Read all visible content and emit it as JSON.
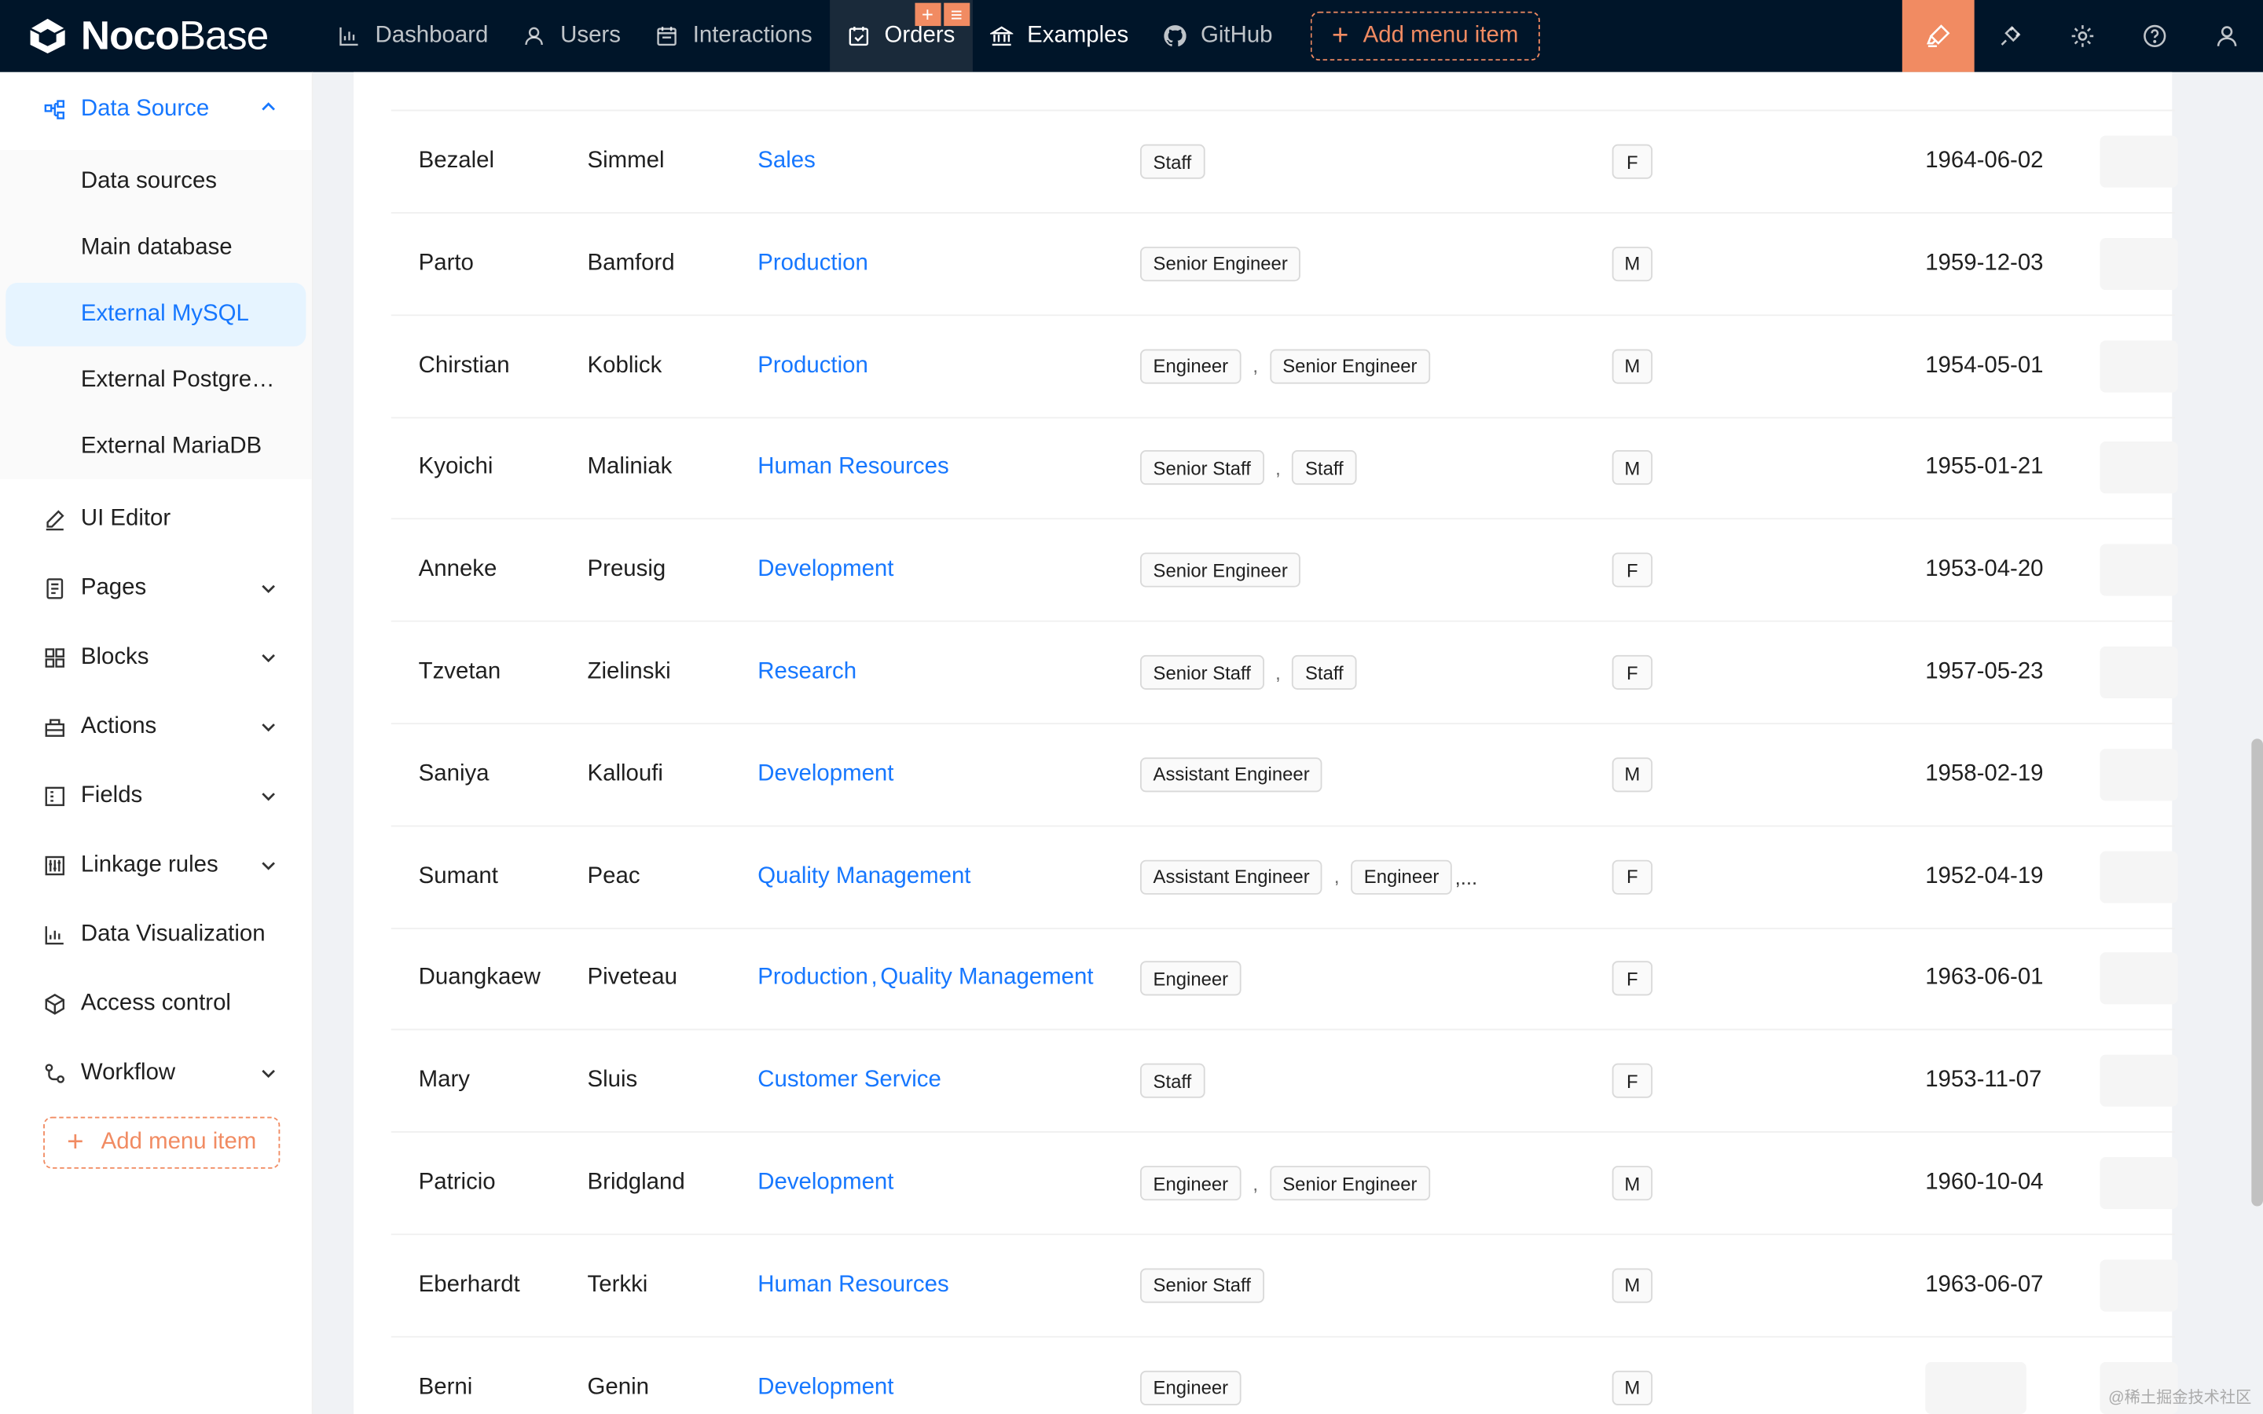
{
  "brand": {
    "bold": "Noco",
    "light": "Base"
  },
  "topnav": [
    {
      "label": "Dashboard",
      "icon": "bar-chart-icon"
    },
    {
      "label": "Users",
      "icon": "user-icon"
    },
    {
      "label": "Interactions",
      "icon": "calendar-icon"
    },
    {
      "label": "Orders",
      "icon": "calendar-check-icon",
      "active": true
    },
    {
      "label": "Examples",
      "icon": "bank-icon"
    },
    {
      "label": "GitHub",
      "icon": "github-icon"
    }
  ],
  "topbar": {
    "add_menu_item": "Add menu item"
  },
  "sidebar": {
    "group": "Data Source",
    "sub_items": [
      "Data sources",
      "Main database",
      "External MySQL",
      "External PostgreSQL",
      "External MariaDB"
    ],
    "items": [
      {
        "label": "UI Editor",
        "icon": "edit-icon"
      },
      {
        "label": "Pages",
        "icon": "file-icon"
      },
      {
        "label": "Blocks",
        "icon": "blocks-icon"
      },
      {
        "label": "Actions",
        "icon": "actions-icon"
      },
      {
        "label": "Fields",
        "icon": "fields-icon"
      },
      {
        "label": "Linkage rules",
        "icon": "linkage-icon"
      },
      {
        "label": "Data Visualization",
        "icon": "chart-icon"
      },
      {
        "label": "Access control",
        "icon": "access-icon"
      },
      {
        "label": "Workflow",
        "icon": "workflow-icon"
      }
    ],
    "add_menu_item": "Add menu item"
  },
  "rows": [
    {
      "first": "Bezalel",
      "last": "Simmel",
      "dept": [
        "Sales"
      ],
      "titles": [
        "Staff"
      ],
      "gender": "F",
      "birth": "1964-06-02"
    },
    {
      "first": "Parto",
      "last": "Bamford",
      "dept": [
        "Production"
      ],
      "titles": [
        "Senior Engineer"
      ],
      "gender": "M",
      "birth": "1959-12-03"
    },
    {
      "first": "Chirstian",
      "last": "Koblick",
      "dept": [
        "Production"
      ],
      "titles": [
        "Engineer",
        "Senior Engineer"
      ],
      "gender": "M",
      "birth": "1954-05-01"
    },
    {
      "first": "Kyoichi",
      "last": "Maliniak",
      "dept": [
        "Human Resources"
      ],
      "titles": [
        "Senior Staff",
        "Staff"
      ],
      "gender": "M",
      "birth": "1955-01-21"
    },
    {
      "first": "Anneke",
      "last": "Preusig",
      "dept": [
        "Development"
      ],
      "titles": [
        "Senior Engineer"
      ],
      "gender": "F",
      "birth": "1953-04-20"
    },
    {
      "first": "Tzvetan",
      "last": "Zielinski",
      "dept": [
        "Research"
      ],
      "titles": [
        "Senior Staff",
        "Staff"
      ],
      "gender": "F",
      "birth": "1957-05-23"
    },
    {
      "first": "Saniya",
      "last": "Kalloufi",
      "dept": [
        "Development"
      ],
      "titles": [
        "Assistant Engineer"
      ],
      "gender": "M",
      "birth": "1958-02-19"
    },
    {
      "first": "Sumant",
      "last": "Peac",
      "dept": [
        "Quality Management"
      ],
      "titles": [
        "Assistant Engineer",
        "Engineer"
      ],
      "more": ",...",
      "gender": "F",
      "birth": "1952-04-19"
    },
    {
      "first": "Duangkaew",
      "last": "Piveteau",
      "dept": [
        "Production",
        "Quality Management"
      ],
      "titles": [
        "Engineer"
      ],
      "gender": "F",
      "birth": "1963-06-01"
    },
    {
      "first": "Mary",
      "last": "Sluis",
      "dept": [
        "Customer Service"
      ],
      "titles": [
        "Staff"
      ],
      "gender": "F",
      "birth": "1953-11-07"
    },
    {
      "first": "Patricio",
      "last": "Bridgland",
      "dept": [
        "Development"
      ],
      "titles": [
        "Engineer",
        "Senior Engineer"
      ],
      "gender": "M",
      "birth": "1960-10-04"
    },
    {
      "first": "Eberhardt",
      "last": "Terkki",
      "dept": [
        "Human Resources"
      ],
      "titles": [
        "Senior Staff"
      ],
      "gender": "M",
      "birth": "1963-06-07"
    },
    {
      "first": "Berni",
      "last": "Genin",
      "dept": [
        "Development"
      ],
      "titles": [
        "Engineer"
      ],
      "gender": "M",
      "birth": ""
    }
  ],
  "watermark": "@稀土掘金技术社区",
  "colors": {
    "accent": "#1677ff",
    "design": "#f18b62",
    "header": "#001529"
  }
}
